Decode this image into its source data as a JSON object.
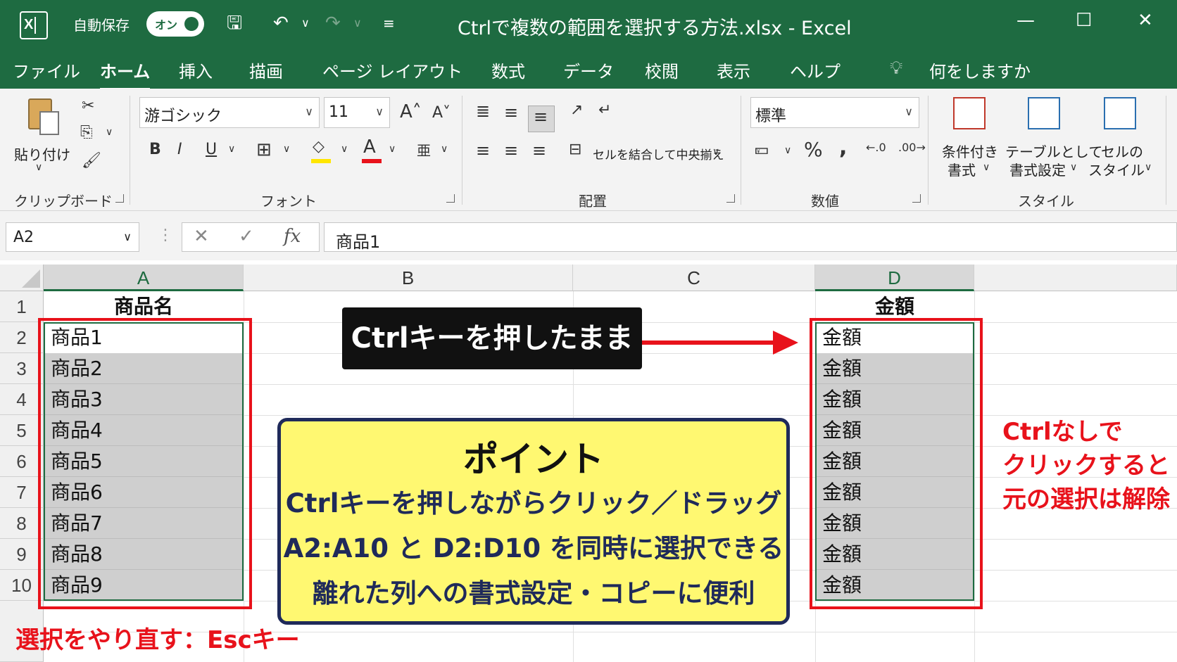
{
  "titlebar": {
    "autosave_label": "自動保存",
    "autosave_state": "オン",
    "title": "Ctrlで複数の範囲を選択する方法.xlsx  -  Excel"
  },
  "tabs": [
    "ファイル",
    "ホーム",
    "挿入",
    "描画",
    "ページ レイアウト",
    "数式",
    "データ",
    "校閲",
    "表示",
    "ヘルプ"
  ],
  "active_tab": "ホーム",
  "tell_me": "何をしますか",
  "ribbon": {
    "clipboard": {
      "paste_label": "貼り付け",
      "group_label": "クリップボード"
    },
    "font": {
      "font_name": "游ゴシック",
      "font_size": "11",
      "bold": "B",
      "italic": "I",
      "underline": "U",
      "group_label": "フォント"
    },
    "alignment": {
      "merge_label": "セルを結合して中央揃え",
      "group_label": "配置"
    },
    "number": {
      "format": "標準",
      "percent": "%",
      "comma": ",",
      "group_label": "数値"
    },
    "styles": {
      "cond_format_1": "条件付き",
      "cond_format_2": "書式",
      "table_format_1": "テーブルとして",
      "table_format_2": "書式設定",
      "cell_styles_1": "セルの",
      "cell_styles_2": "スタイル",
      "group_label": "スタイル"
    }
  },
  "formula_bar": {
    "name_box": "A2",
    "fx": "fx",
    "content": "商品1"
  },
  "grid": {
    "columns": [
      "A",
      "B",
      "C",
      "D"
    ],
    "rows": [
      "1",
      "2",
      "3",
      "4",
      "5",
      "6",
      "7",
      "8",
      "9",
      "10"
    ],
    "col_a": [
      "商品名",
      "商品1",
      "商品2",
      "商品3",
      "商品4",
      "商品5",
      "商品6",
      "商品7",
      "商品8",
      "商品9"
    ],
    "col_d": [
      "金額",
      "金額",
      "金額",
      "金額",
      "金額",
      "金額",
      "金額",
      "金額",
      "金額",
      "金額"
    ],
    "selection_color": "#1e6b41"
  },
  "callouts": {
    "ctrl_hold": "Ctrlキーを押したまま",
    "point_title": "ポイント",
    "point_lines": [
      "Ctrlキーを押しながらクリック／ドラッグ",
      "A2:A10 と D2:D10 を同時に選択できる",
      "離れた列への書式設定・コピーに便利"
    ],
    "right_note": [
      "Ctrlなしで",
      "クリックすると",
      "元の選択は解除"
    ],
    "bottom_note": "選択をやり直す：Escキー",
    "accent_red": "#e8121b",
    "point_bg": "#fff871"
  }
}
